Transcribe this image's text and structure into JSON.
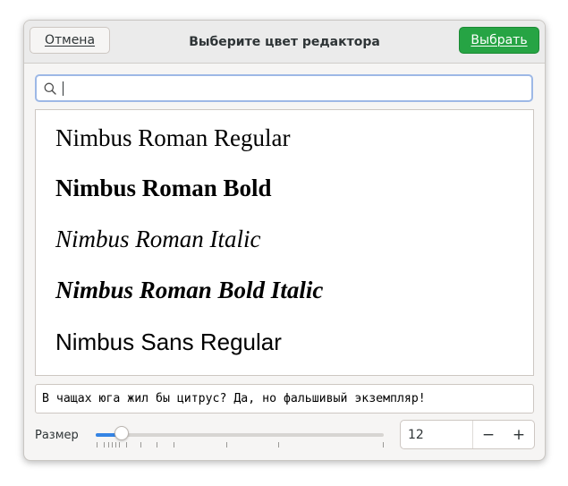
{
  "dialog": {
    "title": "Выберите цвет редактора",
    "cancel_label": "Отмена",
    "select_label": "Выбрать"
  },
  "search": {
    "value": ""
  },
  "fonts": [
    {
      "label": "Nimbus Roman Regular"
    },
    {
      "label": "Nimbus Roman Bold"
    },
    {
      "label": "Nimbus Roman Italic"
    },
    {
      "label": "Nimbus Roman Bold Italic"
    },
    {
      "label": "Nimbus Sans Regular"
    }
  ],
  "preview": {
    "text": "В чащах юга жил бы цитрус? Да, но фальшивый экземпляр!"
  },
  "size": {
    "label": "Размер",
    "value": "12",
    "decrement_symbol": "−",
    "increment_symbol": "+"
  },
  "colors": {
    "accent": "#3584e4",
    "select_button": "#26a444"
  }
}
